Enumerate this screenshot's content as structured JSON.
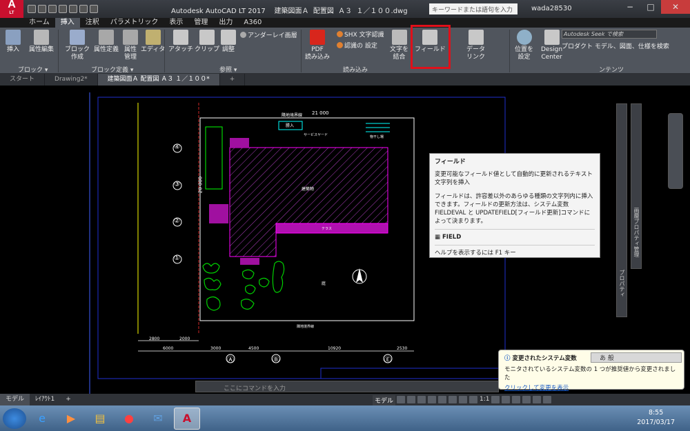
{
  "title": {
    "app_logo": "A",
    "app_logo_sub": "LT",
    "window_title": "Autodesk AutoCAD LT 2017    建築図面Ａ  配置図  Ａ３  １／１００.dwg",
    "search_placeholder": "キーワードまたは語句を入力",
    "user": "wada28530"
  },
  "ribbon_tabs": [
    "ホーム",
    "挿入",
    "注釈",
    "パラメトリック",
    "表示",
    "管理",
    "出力",
    "A360"
  ],
  "active_ribbon_tab": "挿入",
  "ribbon": {
    "insert": "挿入",
    "attr_edit": "属性編集",
    "block_create": "ブロック\n作成",
    "attr_define": "属性定義",
    "attr_manage": "属性\n管理",
    "editor": "エディタ",
    "attach": "アタッチ",
    "clip": "クリップ",
    "adjust": "調整",
    "underlay_layers": "アンダーレイ画層",
    "pdf_import": "PDF\n読み込み",
    "shx_recognize": "SHX 文字認識",
    "recognize_settings": "認識の 設定",
    "text_combine": "文字を\n結合",
    "field": "フィールド",
    "data_link": "データ\nリンク",
    "location": "位置を\n設定",
    "design_center": "Design\nCenter",
    "seek_placeholder": "Autodesk Seek で検索",
    "product_models": "プロダクト モデル、図面、仕様を検索",
    "panel_block": "ブロック ▾",
    "panel_block_def": "ブロック定義 ▾",
    "panel_reference": "参照 ▾",
    "panel_import": "読み込み",
    "panel_contents": "ンテンツ"
  },
  "file_tabs": [
    "スタート",
    "Drawing2*",
    "建築図面Ａ  配置図  Ａ３  １／１００*"
  ],
  "tooltip": {
    "title": "フィールド",
    "desc": "変更可能なフィールド値として自動的に更新されるテキスト文字列を挿入",
    "detail": "フィールドは、許容差以外のあらゆる種類の文字列内に挿入できます。フィールドの更新方法は、システム変数 FIELDEVAL と UPDATEFIELD[フィールド更新]コマンドによって決まります。",
    "command": "FIELD",
    "help": "ヘルプを表示するには F1 キー"
  },
  "drawing": {
    "boundary_top": "隣地境界線",
    "dim_21000": "21 000",
    "dim_20000": "20 000",
    "entrance": "勝入",
    "service_yard": "サービスヤード",
    "drying_area": "物干し場",
    "building": "建築物",
    "terrace": "テラス",
    "garden": "庭",
    "boundary_bottom": "隣地境界線",
    "axis_a": "Ⓐ",
    "axis_b": "Ⓑ",
    "axis_e": "Ⓔ",
    "axis_1": "①",
    "axis_2": "②",
    "axis_3": "③",
    "axis_4": "④",
    "dims_bottom": [
      "6000",
      "3000",
      "4500",
      "10920",
      "2530"
    ],
    "dims_left": [
      "2800",
      "2000"
    ]
  },
  "palettes": {
    "properties": "プロパティ",
    "layer_props": "画層プロパティ管理"
  },
  "command_line": "ここにコマンドを入力",
  "status": {
    "model_tab": "モデル",
    "layout_tab": "ﾚｲｱｳﾄ1",
    "model_btn": "モデル",
    "scale": "1:1"
  },
  "balloon": {
    "title": "変更されたシステム変数",
    "message": "モニタされているシステム変数の 1 つが推奨値から変更されました",
    "link": "クリックして変更を表示"
  },
  "ime": "あ 般",
  "clock": {
    "time": "8:55",
    "date": "2017/03/17"
  }
}
